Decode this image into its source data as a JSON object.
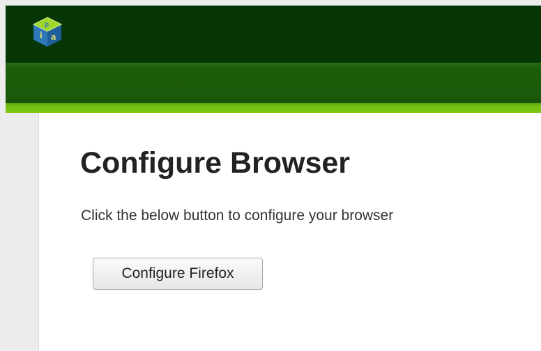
{
  "app": {
    "logo_icon": "ipa-cube-logo-icon",
    "logo_letters": "ipa"
  },
  "colors": {
    "header": "#063506",
    "navbar": "#1b590a",
    "accent": "#7fc715",
    "sidebar": "#ececec"
  },
  "main": {
    "title": "Configure Browser",
    "description": "Click the below button to configure your browser",
    "configure_button_label": "Configure Firefox"
  }
}
